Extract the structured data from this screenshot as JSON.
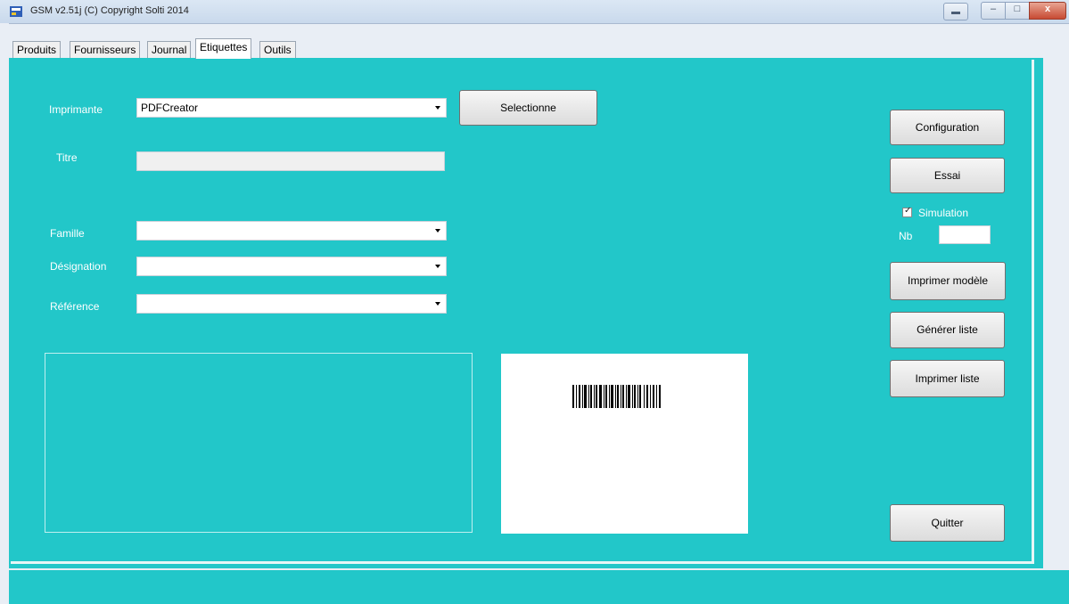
{
  "window": {
    "title": "GSM v2.51j (C) Copyright Solti 2014",
    "close_glyph": "x",
    "max_glyph": "□",
    "min_glyph": "–"
  },
  "tabs": [
    {
      "label": "Produits"
    },
    {
      "label": "Fournisseurs"
    },
    {
      "label": "Journal"
    },
    {
      "label": "Etiquettes",
      "active": true
    },
    {
      "label": "Outils"
    }
  ],
  "form": {
    "printer_label": "Imprimante",
    "printer_value": "PDFCreator",
    "select_button": "Selectionne",
    "title_label": "Titre",
    "title_value": "",
    "family_label": "Famille",
    "family_value": "",
    "designation_label": "Désignation",
    "designation_value": "",
    "reference_label": "Référence",
    "reference_value": ""
  },
  "right_panel": {
    "configuration": "Configuration",
    "essai": "Essai",
    "simulation_label": "Simulation",
    "simulation_checked": true,
    "nb_label": "Nb",
    "nb_value": "",
    "print_model": "Imprimer modèle",
    "generate_list": "Générer liste",
    "print_list": "Imprimer liste",
    "quit": "Quitter"
  },
  "icons": {
    "app": "gsm-app-icon",
    "combo": "chevron-down-icon",
    "barcode": "barcode-icon"
  },
  "colors": {
    "panel_background": "#22c7c9",
    "label_text": "#ffffff"
  }
}
